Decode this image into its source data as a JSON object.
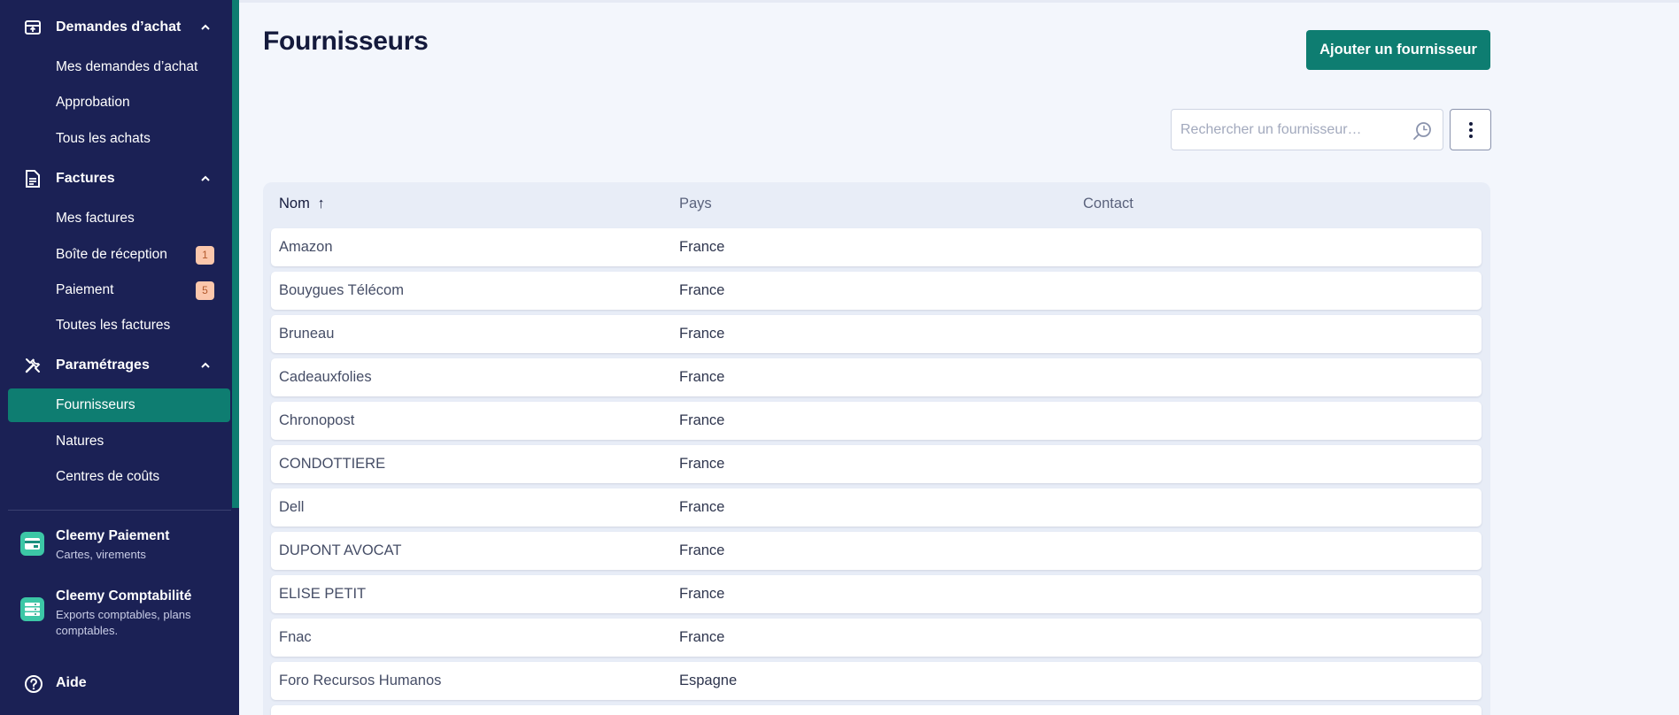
{
  "sidebar": {
    "sections": [
      {
        "label": "Demandes d’achat",
        "icon": "purchase-box-icon",
        "items": [
          {
            "label": "Mes demandes d’achat"
          },
          {
            "label": "Approbation"
          },
          {
            "label": "Tous les achats"
          }
        ]
      },
      {
        "label": "Factures",
        "icon": "invoice-icon",
        "items": [
          {
            "label": "Mes factures"
          },
          {
            "label": "Boîte de réception",
            "badge": "1"
          },
          {
            "label": "Paiement",
            "badge": "5"
          },
          {
            "label": "Toutes les factures"
          }
        ]
      },
      {
        "label": "Paramétrages",
        "icon": "tools-icon",
        "items": [
          {
            "label": "Fournisseurs",
            "active": true
          },
          {
            "label": "Natures"
          },
          {
            "label": "Centres de coûts"
          }
        ]
      }
    ],
    "apps": [
      {
        "title": "Cleemy Paiement",
        "subtitle": "Cartes, virements",
        "icon": "payment-card-icon"
      },
      {
        "title": "Cleemy Comptabilité",
        "subtitle": "Exports comptables, plans comptables.",
        "icon": "accounting-icon"
      }
    ],
    "help": {
      "label": "Aide",
      "icon": "help-circle-icon"
    },
    "colors": {
      "background": "#1b2155",
      "active": "#0e7d71",
      "badge": "#fbc7ac"
    }
  },
  "header": {
    "title": "Fournisseurs",
    "add_button": "Ajouter un fournisseur"
  },
  "search": {
    "placeholder": "Rechercher un fournisseur…",
    "value": ""
  },
  "table": {
    "columns": {
      "nom": "Nom",
      "pays": "Pays",
      "contact": "Contact",
      "sort_indicator": "↑"
    },
    "rows": [
      {
        "nom": "Amazon",
        "pays": "France",
        "contact": ""
      },
      {
        "nom": "Bouygues Télécom",
        "pays": "France",
        "contact": ""
      },
      {
        "nom": "Bruneau",
        "pays": "France",
        "contact": ""
      },
      {
        "nom": "Cadeauxfolies",
        "pays": "France",
        "contact": ""
      },
      {
        "nom": "Chronopost",
        "pays": "France",
        "contact": ""
      },
      {
        "nom": "CONDOTTIERE",
        "pays": "France",
        "contact": ""
      },
      {
        "nom": "Dell",
        "pays": "France",
        "contact": ""
      },
      {
        "nom": "DUPONT AVOCAT",
        "pays": "France",
        "contact": ""
      },
      {
        "nom": "ELISE PETIT",
        "pays": "France",
        "contact": ""
      },
      {
        "nom": "Fnac",
        "pays": "France",
        "contact": ""
      },
      {
        "nom": "Foro Recursos Humanos",
        "pays": "Espagne",
        "contact": ""
      },
      {
        "nom": "",
        "pays": "",
        "contact": ""
      }
    ]
  }
}
